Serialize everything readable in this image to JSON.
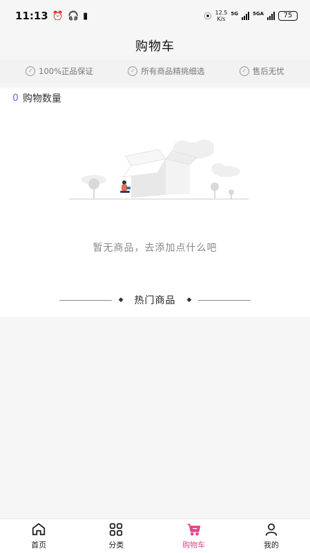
{
  "status_bar": {
    "time": "11:13",
    "speed_top": "12.5",
    "speed_bottom": "K/s",
    "net1": "5G",
    "net2": "5GA",
    "battery": "75"
  },
  "header": {
    "title": "购物车"
  },
  "promises": [
    {
      "label": "100%正品保证"
    },
    {
      "label": "所有商品精挑细选"
    },
    {
      "label": "售后无忧"
    }
  ],
  "cart": {
    "count": "0",
    "count_label": "购物数量",
    "empty_text": "暂无商品，去添加点什么吧"
  },
  "hot": {
    "title": "热门商品"
  },
  "tabs": [
    {
      "label": "首页",
      "icon": "home-icon"
    },
    {
      "label": "分类",
      "icon": "grid-icon"
    },
    {
      "label": "购物车",
      "icon": "cart-icon",
      "active": true
    },
    {
      "label": "我的",
      "icon": "user-icon"
    }
  ],
  "colors": {
    "accent": "#e0458a",
    "count": "#6b6bd6"
  }
}
